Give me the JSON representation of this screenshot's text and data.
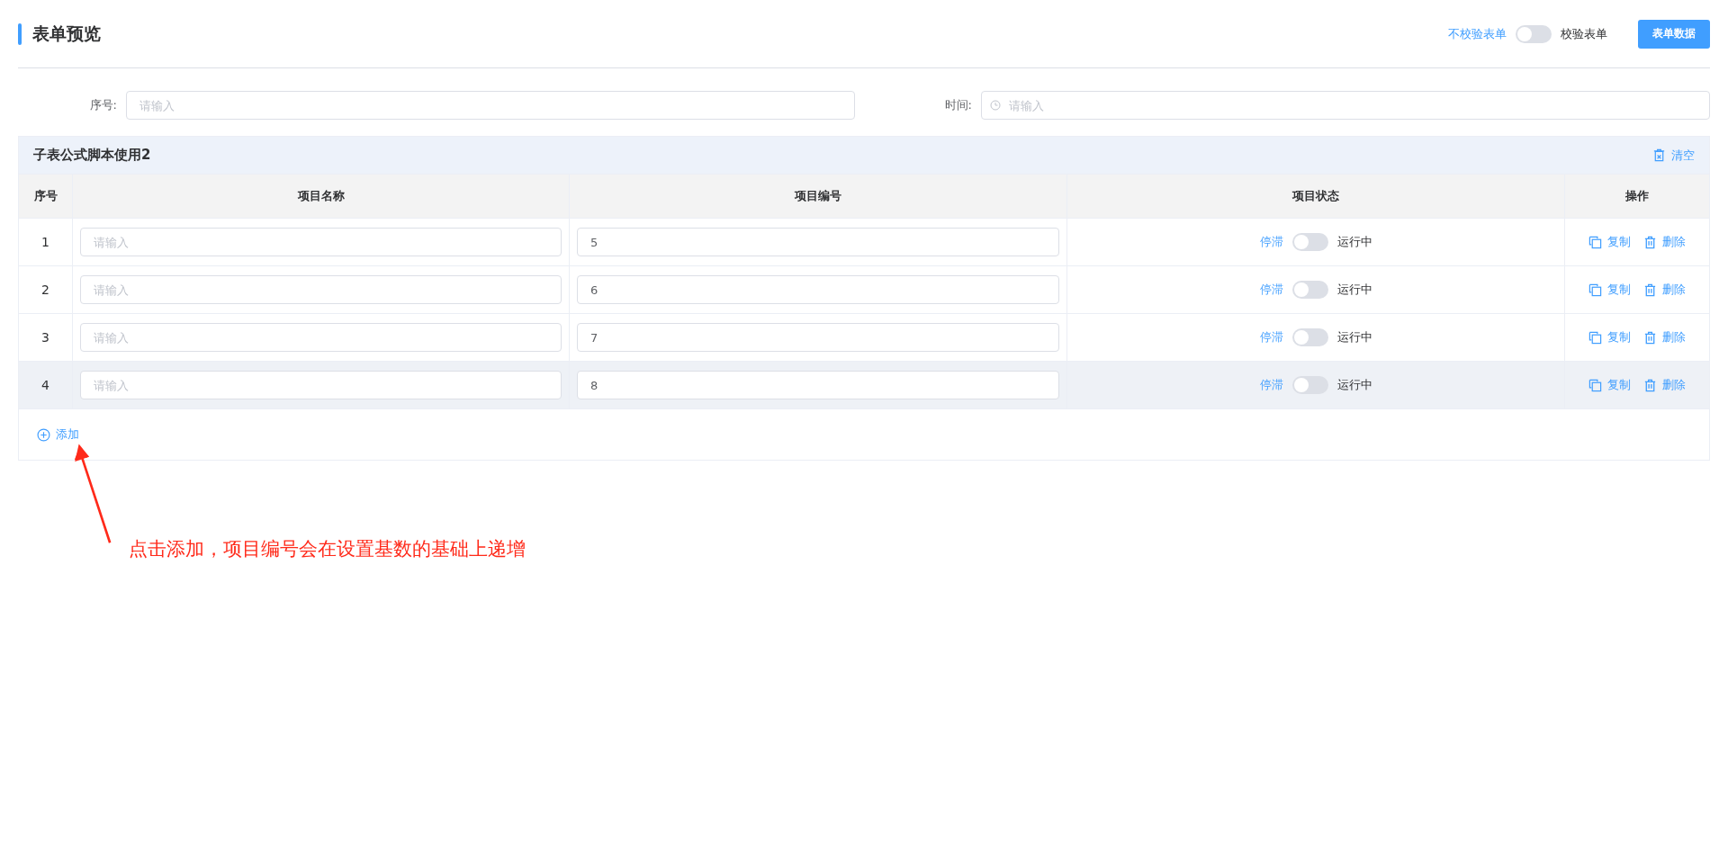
{
  "page_title": "表单预览",
  "header_controls": {
    "off_label": "不校验表单",
    "on_label": "校验表单",
    "validate_on": false,
    "data_button": "表单数据"
  },
  "form_fields": [
    {
      "label": "序号:",
      "placeholder": "请输入",
      "kind": "text"
    },
    {
      "label": "时间:",
      "placeholder": "请输入",
      "kind": "time"
    }
  ],
  "subtable": {
    "title": "子表公式脚本使用2",
    "clear_button": "清空",
    "columns": [
      "序号",
      "项目名称",
      "项目编号",
      "项目状态",
      "操作"
    ],
    "rows": [
      {
        "index": "1",
        "name_placeholder": "请输入",
        "number": "5",
        "status_off": "停滞",
        "status_on": "运行中",
        "running": false,
        "hovered": false,
        "copy": "复制",
        "delete": "删除"
      },
      {
        "index": "2",
        "name_placeholder": "请输入",
        "number": "6",
        "status_off": "停滞",
        "status_on": "运行中",
        "running": false,
        "hovered": false,
        "copy": "复制",
        "delete": "删除"
      },
      {
        "index": "3",
        "name_placeholder": "请输入",
        "number": "7",
        "status_off": "停滞",
        "status_on": "运行中",
        "running": false,
        "hovered": false,
        "copy": "复制",
        "delete": "删除"
      },
      {
        "index": "4",
        "name_placeholder": "请输入",
        "number": "8",
        "status_off": "停滞",
        "status_on": "运行中",
        "running": false,
        "hovered": true,
        "copy": "复制",
        "delete": "删除"
      }
    ],
    "add_button": "添加"
  },
  "annotation": {
    "text": "点击添加，项目编号会在设置基数的基础上递增"
  }
}
